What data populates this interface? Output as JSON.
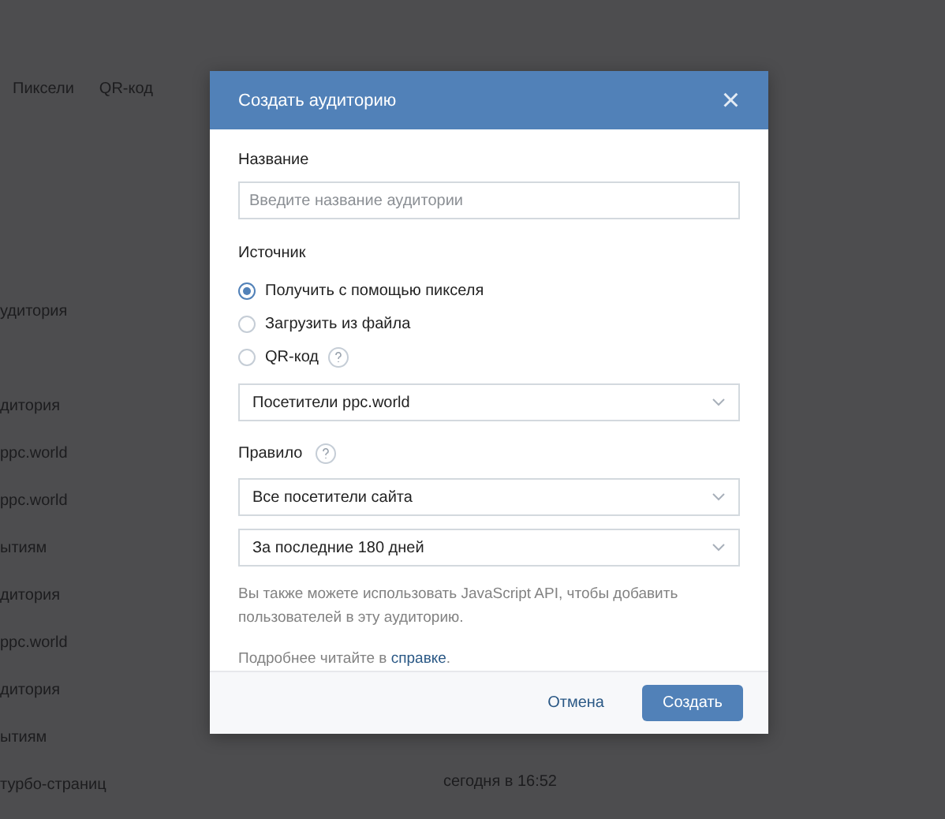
{
  "background": {
    "tabs": [
      "Пиксели",
      "QR-код"
    ],
    "rows": [
      {
        "name": "удитория",
        "time": ""
      },
      {
        "name": "",
        "time": ""
      },
      {
        "name": "дитория",
        "time": ""
      },
      {
        "name": "ppc.world",
        "time": ""
      },
      {
        "name": "ppc.world",
        "time": ""
      },
      {
        "name": "ытиям",
        "time": ""
      },
      {
        "name": "дитория",
        "time": ""
      },
      {
        "name": "ppc.world",
        "time": ""
      },
      {
        "name": "дитория",
        "time": ""
      },
      {
        "name": "ытиям",
        "time": ""
      },
      {
        "name": "турбо-страниц",
        "time": "сегодня в 16:52"
      }
    ]
  },
  "dialog": {
    "title": "Создать аудиторию",
    "close": "×",
    "name_label": "Название",
    "name_placeholder": "Введите название аудитории",
    "source_label": "Источник",
    "sources": [
      {
        "label": "Получить с помощью пикселя",
        "selected": true,
        "help": false
      },
      {
        "label": "Загрузить из файла",
        "selected": false,
        "help": false
      },
      {
        "label": "QR-код",
        "selected": false,
        "help": true
      }
    ],
    "pixel_select": "Посетители ppc.world",
    "rule_label": "Правило",
    "rule_help": true,
    "rule_selects": [
      "Все посетители сайта",
      "За последние 180 дней"
    ],
    "api_note": "Вы также можете использовать JavaScript API, чтобы добавить пользователей в эту аудиторию.",
    "help_text": "Подробнее читайте в",
    "help_link": "справке",
    "help_end": ".",
    "buttons": {
      "cancel": "Отмена",
      "create": "Создать"
    }
  }
}
